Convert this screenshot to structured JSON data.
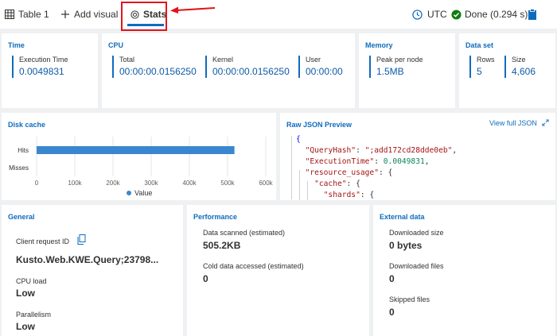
{
  "tabs": {
    "table": "Table 1",
    "add_visual": "Add visual",
    "stats": "Stats"
  },
  "toolbar": {
    "timezone": "UTC",
    "status": "Done (0.294 s)"
  },
  "time": {
    "title": "Time",
    "execution_label": "Execution Time",
    "execution_value": "0.0049831"
  },
  "cpu": {
    "title": "CPU",
    "total_label": "Total",
    "total_value": "00:00:00.0156250",
    "kernel_label": "Kernel",
    "kernel_value": "00:00:00.0156250",
    "user_label": "User",
    "user_value": "00:00:00"
  },
  "memory": {
    "title": "Memory",
    "peak_label": "Peak per node",
    "peak_value": "1.5MB"
  },
  "dataset": {
    "title": "Data set",
    "rows_label": "Rows",
    "rows_value": "5",
    "size_label": "Size",
    "size_value": "4,606"
  },
  "disk_cache": {
    "title": "Disk cache"
  },
  "chart_data": {
    "type": "bar",
    "orientation": "horizontal",
    "categories": [
      "Hits",
      "Misses"
    ],
    "series": [
      {
        "name": "Value",
        "values": [
          518000,
          0
        ]
      }
    ],
    "ticks": [
      "0",
      "100k",
      "200k",
      "300k",
      "400k",
      "500k",
      "600k"
    ],
    "xlim": [
      0,
      600000
    ],
    "legend": "bottom",
    "color": "#3a87d0"
  },
  "json_preview": {
    "title": "Raw JSON Preview",
    "view_full": "View full JSON",
    "line1": "{",
    "key_queryhash": "\"QueryHash\"",
    "val_queryhash": "\";add172cd28dde0eb\"",
    "key_exec": "\"ExecutionTime\"",
    "val_exec": "0.0049831",
    "key_resource": "\"resource_usage\"",
    "key_cache": "\"cache\"",
    "key_shards": "\"shards\""
  },
  "general": {
    "title": "General",
    "client_label": "Client request ID",
    "client_value": "Kusto.Web.KWE.Query;23798...",
    "cpu_load_label": "CPU load",
    "cpu_load_value": "Low",
    "parallelism_label": "Parallelism",
    "parallelism_value": "Low"
  },
  "performance": {
    "title": "Performance",
    "scanned_label": "Data scanned (estimated)",
    "scanned_value": "505.2KB",
    "cold_label": "Cold data accessed (estimated)",
    "cold_value": "0"
  },
  "external": {
    "title": "External data",
    "downloaded_size_label": "Downloaded size",
    "downloaded_size_value": "0 bytes",
    "downloaded_files_label": "Downloaded files",
    "downloaded_files_value": "0",
    "skipped_label": "Skipped files",
    "skipped_value": "0"
  }
}
